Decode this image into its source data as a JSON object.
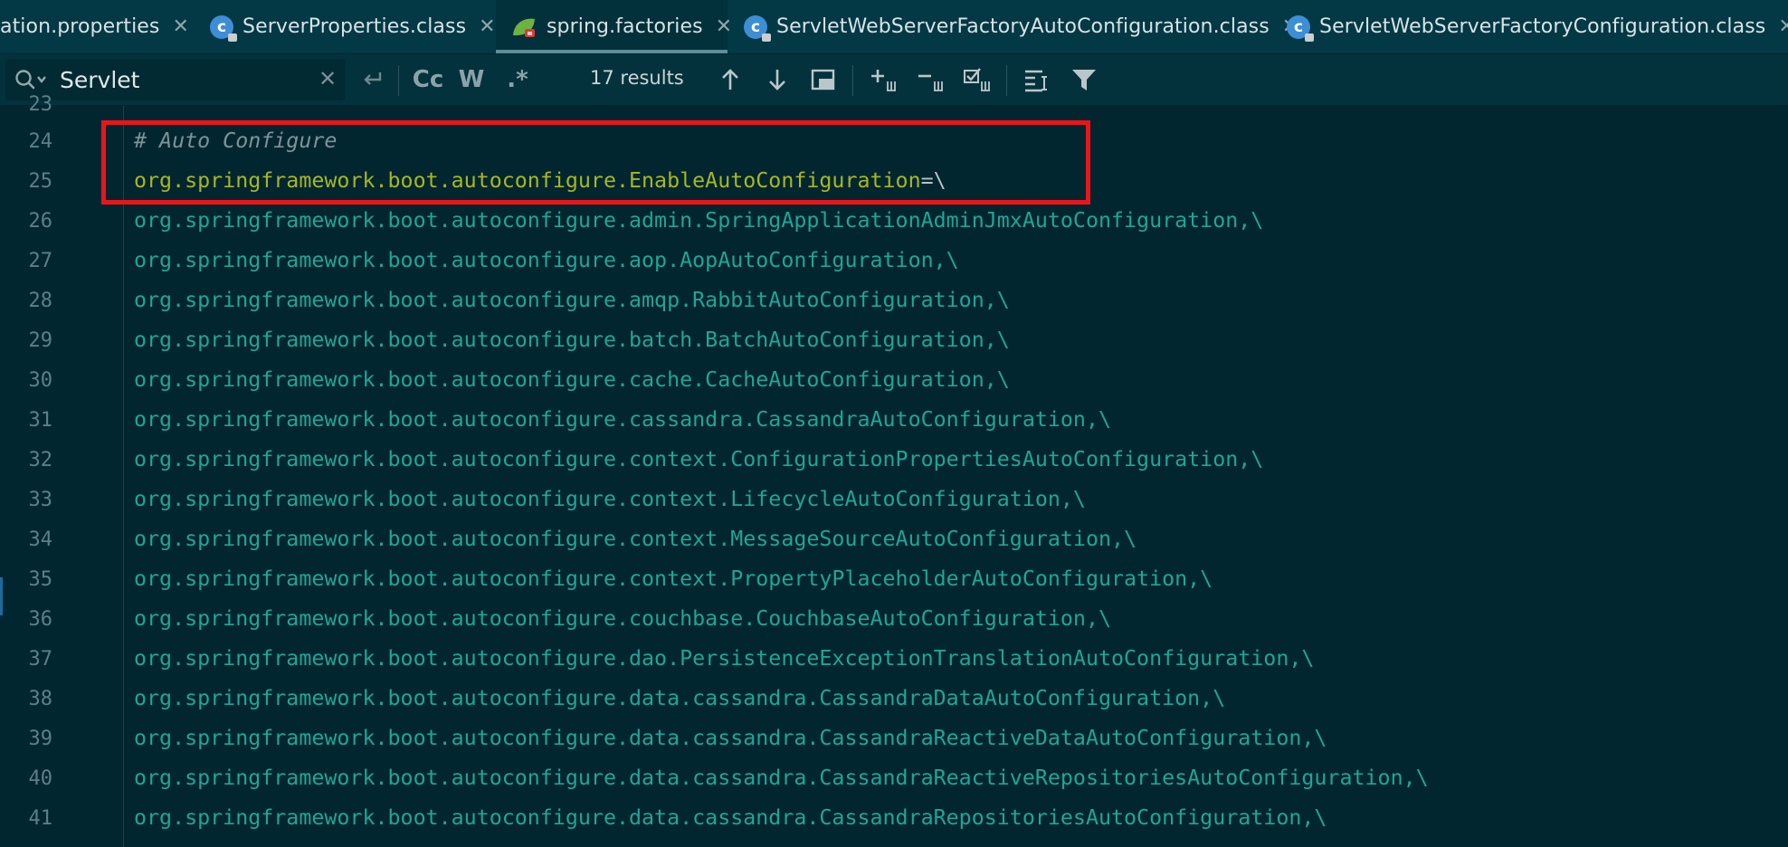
{
  "tabs": [
    {
      "label": "ation.properties",
      "icon": "properties-file-icon",
      "active": false
    },
    {
      "label": "ServerProperties.class",
      "icon": "class-file-icon",
      "active": false
    },
    {
      "label": "spring.factories",
      "icon": "spring-file-icon",
      "active": true
    },
    {
      "label": "ServletWebServerFactoryAutoConfiguration.class",
      "icon": "class-file-icon",
      "active": false
    },
    {
      "label": "ServletWebServerFactoryConfiguration.class",
      "icon": "class-file-icon",
      "active": false
    }
  ],
  "tab_close_glyph": "✕",
  "search": {
    "query": "Servlet",
    "results": "17 results",
    "match_case": "Cc",
    "whole_words": "W",
    "regex": ".*"
  },
  "editor": {
    "partial_top_line_number": "23",
    "lines": [
      {
        "n": "24",
        "text": "# Auto Configure"
      },
      {
        "n": "25",
        "text": "org.springframework.boot.autoconfigure.EnableAutoConfiguration",
        "suffix": "=\\"
      },
      {
        "n": "26",
        "text": "org.springframework.boot.autoconfigure.admin.SpringApplicationAdminJmxAutoConfiguration,\\"
      },
      {
        "n": "27",
        "text": "org.springframework.boot.autoconfigure.aop.AopAutoConfiguration,\\"
      },
      {
        "n": "28",
        "text": "org.springframework.boot.autoconfigure.amqp.RabbitAutoConfiguration,\\"
      },
      {
        "n": "29",
        "text": "org.springframework.boot.autoconfigure.batch.BatchAutoConfiguration,\\"
      },
      {
        "n": "30",
        "text": "org.springframework.boot.autoconfigure.cache.CacheAutoConfiguration,\\"
      },
      {
        "n": "31",
        "text": "org.springframework.boot.autoconfigure.cassandra.CassandraAutoConfiguration,\\"
      },
      {
        "n": "32",
        "text": "org.springframework.boot.autoconfigure.context.ConfigurationPropertiesAutoConfiguration,\\"
      },
      {
        "n": "33",
        "text": "org.springframework.boot.autoconfigure.context.LifecycleAutoConfiguration,\\"
      },
      {
        "n": "34",
        "text": "org.springframework.boot.autoconfigure.context.MessageSourceAutoConfiguration,\\"
      },
      {
        "n": "35",
        "text": "org.springframework.boot.autoconfigure.context.PropertyPlaceholderAutoConfiguration,\\"
      },
      {
        "n": "36",
        "text": "org.springframework.boot.autoconfigure.couchbase.CouchbaseAutoConfiguration,\\"
      },
      {
        "n": "37",
        "text": "org.springframework.boot.autoconfigure.dao.PersistenceExceptionTranslationAutoConfiguration,\\"
      },
      {
        "n": "38",
        "text": "org.springframework.boot.autoconfigure.data.cassandra.CassandraDataAutoConfiguration,\\"
      },
      {
        "n": "39",
        "text": "org.springframework.boot.autoconfigure.data.cassandra.CassandraReactiveDataAutoConfiguration,\\"
      },
      {
        "n": "40",
        "text": "org.springframework.boot.autoconfigure.data.cassandra.CassandraReactiveRepositoriesAutoConfiguration,\\"
      },
      {
        "n": "41",
        "text": "org.springframework.boot.autoconfigure.data.cassandra.CassandraRepositoriesAutoConfiguration,\\"
      }
    ]
  },
  "colors": {
    "background": "#022630",
    "code_value": "#20a596",
    "code_key": "#a7b623",
    "comment": "#7d9399",
    "highlight_box": "#ec1419"
  }
}
